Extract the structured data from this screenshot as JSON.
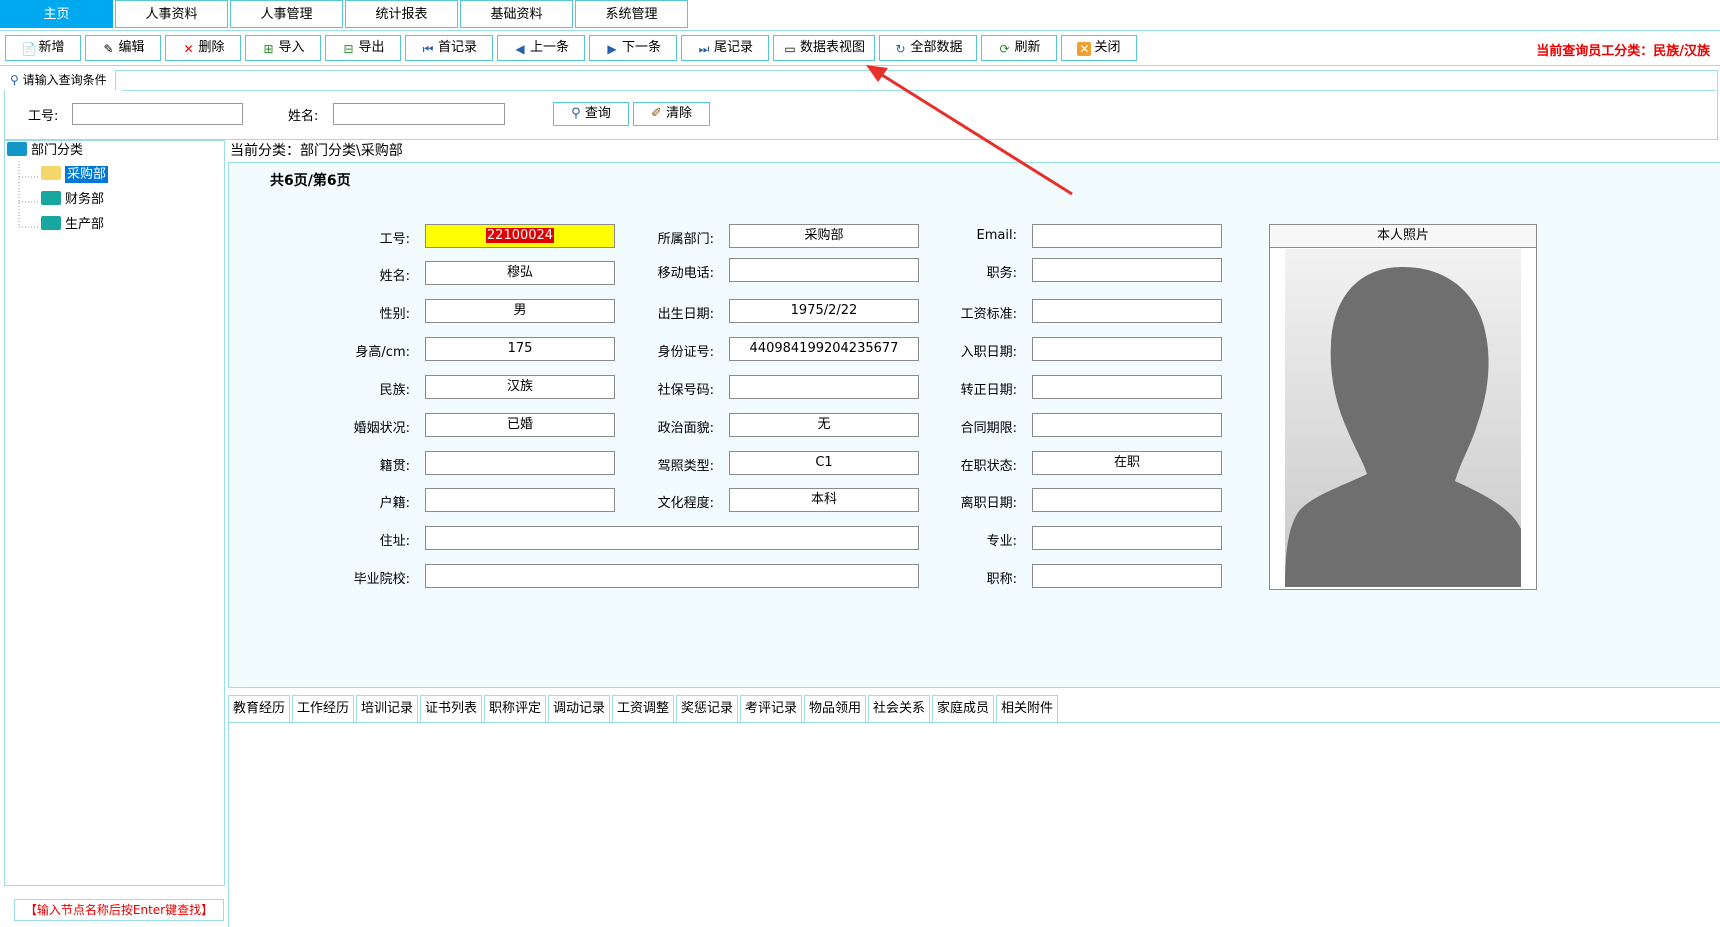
{
  "nav": {
    "tabs": [
      "主页",
      "人事资料",
      "人事管理",
      "统计报表",
      "基础资料",
      "系统管理"
    ],
    "active": 0
  },
  "toolbar": {
    "buttons": [
      "新增",
      "编辑",
      "删除",
      "导入",
      "导出",
      "首记录",
      "上一条",
      "下一条",
      "尾记录",
      "数据表视图",
      "全部数据",
      "刷新",
      "关闭"
    ],
    "status": "当前查询员工分类：民族/汉族"
  },
  "query": {
    "tab_label": "请输入查询条件",
    "id_label": "工号:",
    "name_label": "姓名:",
    "id_value": "",
    "name_value": "",
    "search_label": "查询",
    "clear_label": "清除"
  },
  "tree": {
    "root": "部门分类",
    "items": [
      "采购部",
      "财务部",
      "生产部"
    ],
    "selected": 0,
    "hint": "【输入节点名称后按Enter键查找】"
  },
  "breadcrumb": "当前分类：部门分类\\采购部",
  "pager": "共6页/第6页",
  "form": {
    "col1": [
      {
        "label": "工号:",
        "value": "22100024"
      },
      {
        "label": "姓名:",
        "value": "穆弘"
      },
      {
        "label": "性别:",
        "value": "男"
      },
      {
        "label": "身高/cm:",
        "value": "175"
      },
      {
        "label": "民族:",
        "value": "汉族"
      },
      {
        "label": "婚姻状况:",
        "value": "已婚"
      },
      {
        "label": "籍贯:",
        "value": ""
      },
      {
        "label": "户籍:",
        "value": ""
      },
      {
        "label": "住址:",
        "value": ""
      },
      {
        "label": "毕业院校:",
        "value": ""
      }
    ],
    "col2": [
      {
        "label": "所属部门:",
        "value": "采购部"
      },
      {
        "label": "移动电话:",
        "value": ""
      },
      {
        "label": "出生日期:",
        "value": "1975/2/22"
      },
      {
        "label": "身份证号:",
        "value": "440984199204235677"
      },
      {
        "label": "社保号码:",
        "value": ""
      },
      {
        "label": "政治面貌:",
        "value": "无"
      },
      {
        "label": "驾照类型:",
        "value": "C1"
      },
      {
        "label": "文化程度:",
        "value": "本科"
      }
    ],
    "col3": [
      {
        "label": "Email:",
        "value": ""
      },
      {
        "label": "职务:",
        "value": ""
      },
      {
        "label": "工资标准:",
        "value": ""
      },
      {
        "label": "入职日期:",
        "value": ""
      },
      {
        "label": "转正日期:",
        "value": ""
      },
      {
        "label": "合同期限:",
        "value": ""
      },
      {
        "label": "在职状态:",
        "value": "在职"
      },
      {
        "label": "离职日期:",
        "value": ""
      },
      {
        "label": "专业:",
        "value": ""
      },
      {
        "label": "职称:",
        "value": ""
      }
    ],
    "photo_label": "本人照片",
    "highlight_color": "#ffff00",
    "highlight_text_color": "#e00000"
  },
  "bottom_tabs": [
    "教育经历",
    "工作经历",
    "培训记录",
    "证书列表",
    "职称评定",
    "调动记录",
    "工资调整",
    "奖惩记录",
    "考评记录",
    "物品领用",
    "社会关系",
    "家庭成员",
    "相关附件"
  ],
  "colors": {
    "accent": "#00a8f0",
    "border": "#55c8d8",
    "alert": "#e00000",
    "annotation_arrow": "#e8302a"
  }
}
